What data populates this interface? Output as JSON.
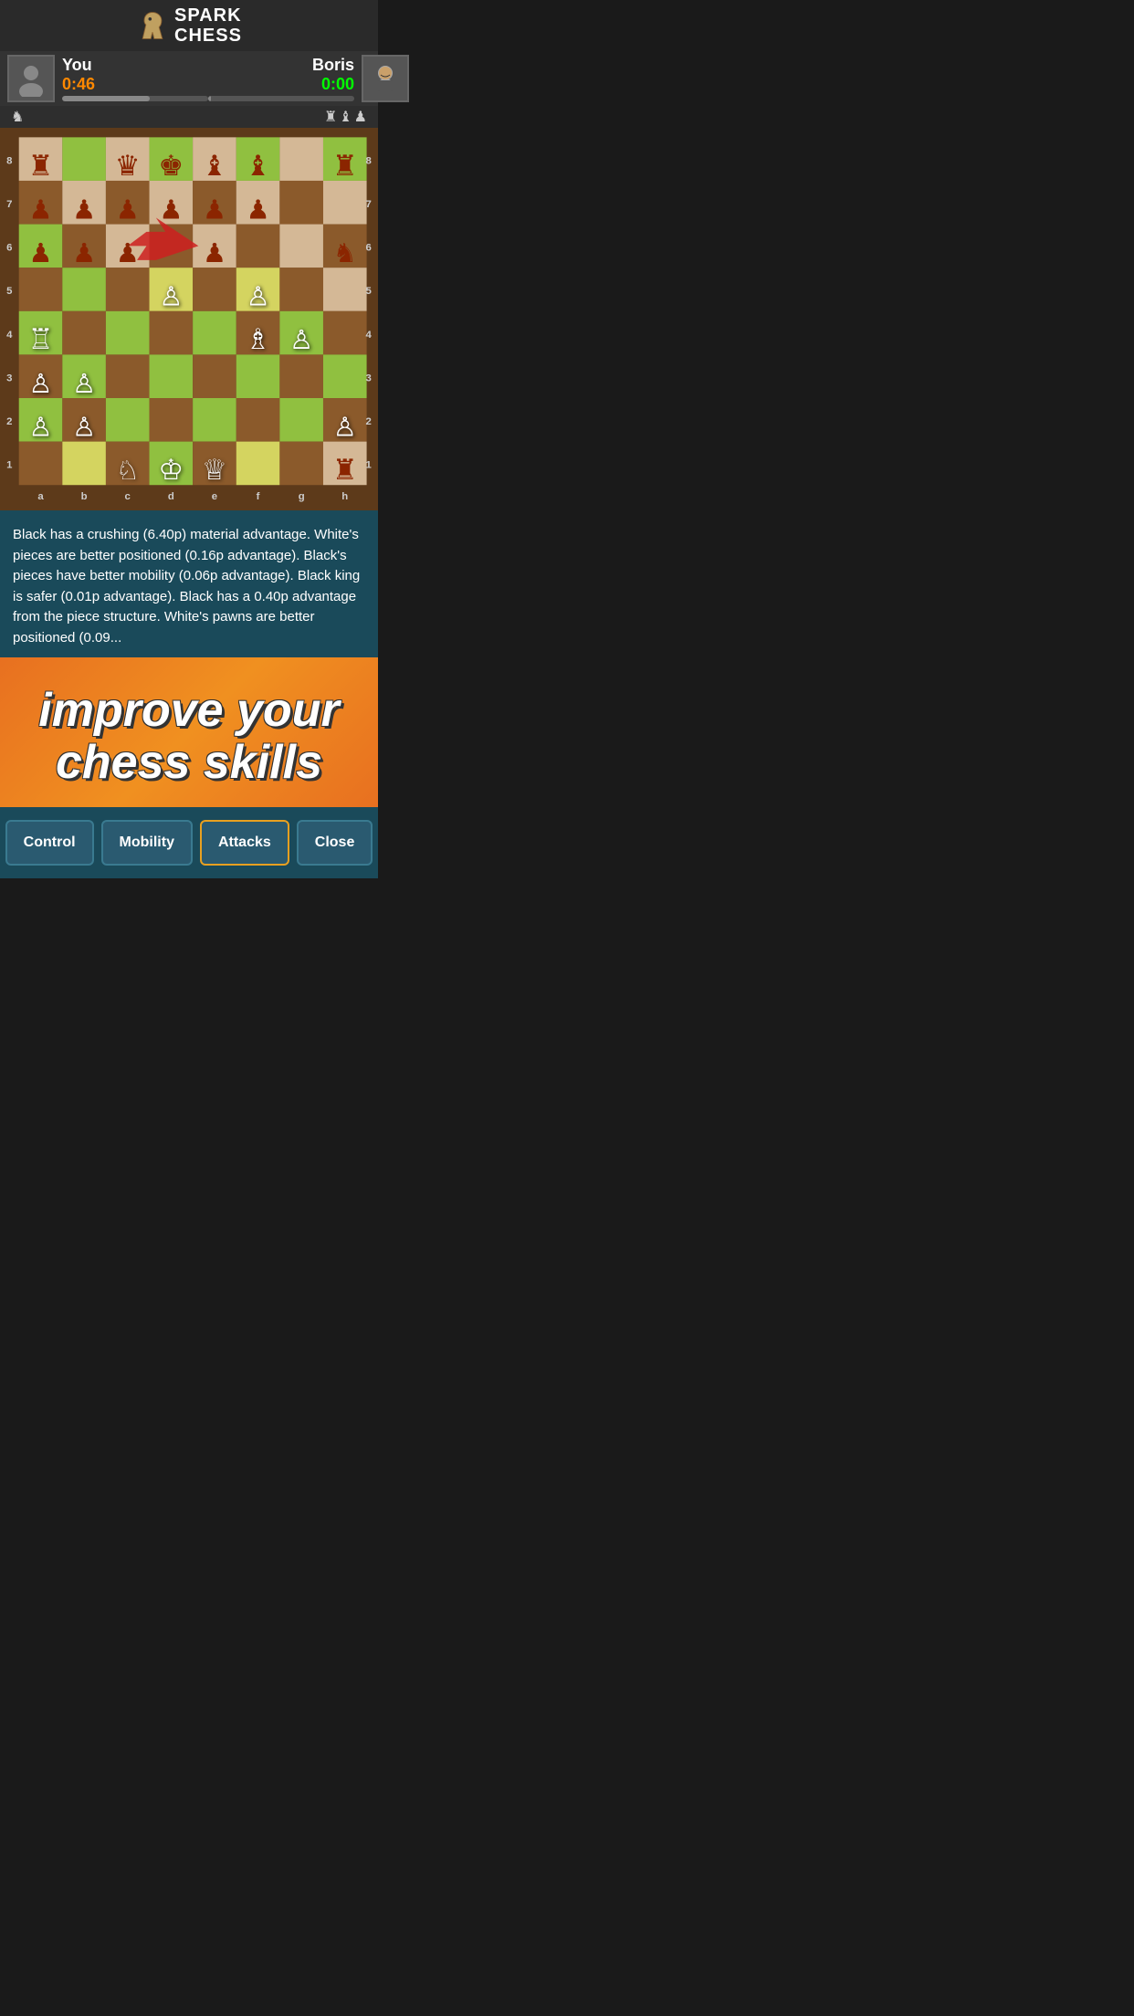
{
  "header": {
    "logo_text_line1": "SPARK",
    "logo_text_line2": "CHESS",
    "registered": "®"
  },
  "player_you": {
    "name": "You",
    "timer": "0:46",
    "timer_class": "timer-orange",
    "progress": 60
  },
  "player_boris": {
    "name": "Boris",
    "timer": "0:00",
    "timer_class": "timer-green",
    "progress": 0
  },
  "captured": {
    "you_icons": [
      "♞"
    ],
    "boris_icons": [
      "♜",
      "♝",
      "♟"
    ]
  },
  "analysis": {
    "text": "Black has a crushing (6.40p) material advantage. White's pieces are better positioned (0.16p advantage). Black's pieces have better mobility (0.06p advantage). Black king is safer (0.01p advantage). Black has a 0.40p advantage from the piece structure. White's pawns are better positioned (0.09..."
  },
  "promo": {
    "line1": "improve your",
    "line2": "chess skills"
  },
  "buttons": [
    {
      "label": "Control",
      "active": false
    },
    {
      "label": "Mobility",
      "active": false
    },
    {
      "label": "Attacks",
      "active": true
    },
    {
      "label": "Close",
      "active": false
    }
  ],
  "board": {
    "ranks": [
      "8",
      "7",
      "6",
      "5",
      "4",
      "3",
      "2",
      "1"
    ],
    "files": [
      "a",
      "b",
      "c",
      "d",
      "e",
      "f",
      "g",
      "h"
    ]
  }
}
